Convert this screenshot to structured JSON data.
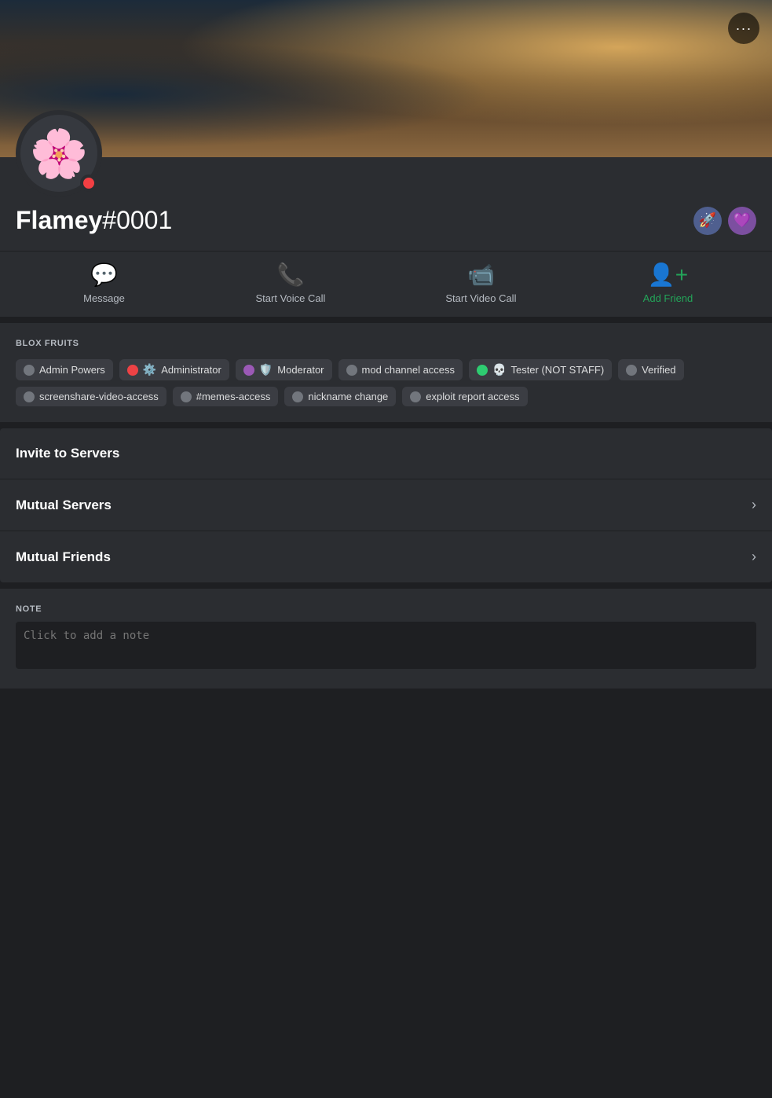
{
  "banner": {
    "more_btn_label": "···"
  },
  "profile": {
    "avatar_emoji": "🌸",
    "avatar_alt": "Flamey avatar - colorful flower emoji",
    "status_color": "#f23f43",
    "username": "Flamey",
    "discriminator": "#0001",
    "badges": [
      {
        "name": "nitro-badge",
        "emoji": "🚀",
        "bg": "#4f5f8f"
      },
      {
        "name": "boost-badge",
        "emoji": "💜",
        "bg": "#7c4fa0"
      }
    ]
  },
  "actions": [
    {
      "name": "message",
      "icon": "💬",
      "label": "Message",
      "green": false
    },
    {
      "name": "voice-call",
      "icon": "📞",
      "label": "Start Voice Call",
      "green": false
    },
    {
      "name": "video-call",
      "icon": "📹",
      "label": "Start Video Call",
      "green": false
    },
    {
      "name": "add-friend",
      "icon": "👤➕",
      "label": "Add Friend",
      "green": true
    }
  ],
  "roles": {
    "section_title": "BLOX FRUITS",
    "items": [
      {
        "label": "Admin Powers",
        "dot_color": "#72767d",
        "emoji": "",
        "has_emoji": false
      },
      {
        "label": "Administrator",
        "dot_color": "#ed4245",
        "emoji": "⚙️",
        "has_emoji": true
      },
      {
        "label": "Moderator",
        "dot_color": "#9b59b6",
        "emoji": "🛡️",
        "has_emoji": true
      },
      {
        "label": "mod channel access",
        "dot_color": "#72767d",
        "emoji": "",
        "has_emoji": false
      },
      {
        "label": "Tester (NOT STAFF)",
        "dot_color": "#2ecc71",
        "emoji": "💀",
        "has_emoji": true
      },
      {
        "label": "Verified",
        "dot_color": "#72767d",
        "emoji": "",
        "has_emoji": false
      },
      {
        "label": "screenshare-video-access",
        "dot_color": "#72767d",
        "emoji": "",
        "has_emoji": false
      },
      {
        "label": "#memes-access",
        "dot_color": "#72767d",
        "emoji": "",
        "has_emoji": false
      },
      {
        "label": "nickname change",
        "dot_color": "#72767d",
        "emoji": "",
        "has_emoji": false
      },
      {
        "label": "exploit report access",
        "dot_color": "#72767d",
        "emoji": "",
        "has_emoji": false
      }
    ]
  },
  "collapsible": [
    {
      "label": "Invite to Servers",
      "has_chevron": false
    },
    {
      "label": "Mutual Servers",
      "has_chevron": true
    },
    {
      "label": "Mutual Friends",
      "has_chevron": true
    }
  ],
  "note": {
    "title": "NOTE",
    "placeholder": "Click to add a note"
  }
}
